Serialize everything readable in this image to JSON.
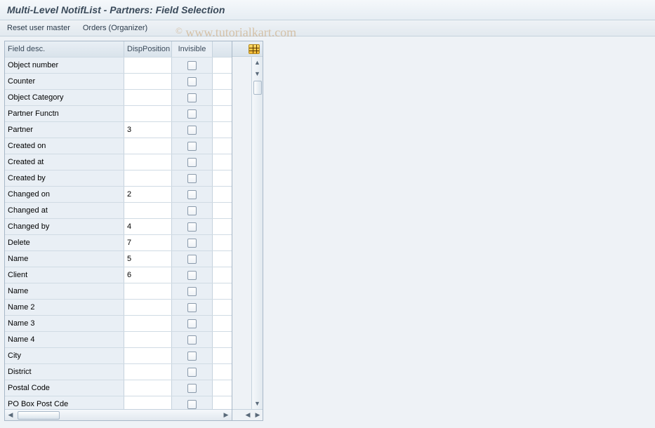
{
  "title": "Multi-Level NotifList - Partners: Field Selection",
  "toolbar": {
    "reset": "Reset user master",
    "orders": "Orders (Organizer)"
  },
  "columns": {
    "field": "Field desc.",
    "pos": "DispPosition",
    "inv": "Invisible"
  },
  "rows": [
    {
      "field": "Object number",
      "pos": ""
    },
    {
      "field": "Counter",
      "pos": ""
    },
    {
      "field": "Object Category",
      "pos": ""
    },
    {
      "field": "Partner Functn",
      "pos": ""
    },
    {
      "field": "Partner",
      "pos": "3"
    },
    {
      "field": "Created on",
      "pos": ""
    },
    {
      "field": "Created at",
      "pos": ""
    },
    {
      "field": "Created by",
      "pos": ""
    },
    {
      "field": "Changed on",
      "pos": "2"
    },
    {
      "field": "Changed at",
      "pos": ""
    },
    {
      "field": "Changed by",
      "pos": "4"
    },
    {
      "field": "Delete",
      "pos": "7"
    },
    {
      "field": "Name",
      "pos": "5"
    },
    {
      "field": "Client",
      "pos": "6"
    },
    {
      "field": "Name",
      "pos": ""
    },
    {
      "field": "Name 2",
      "pos": ""
    },
    {
      "field": "Name 3",
      "pos": ""
    },
    {
      "field": "Name 4",
      "pos": ""
    },
    {
      "field": "City",
      "pos": ""
    },
    {
      "field": "District",
      "pos": ""
    },
    {
      "field": "Postal Code",
      "pos": ""
    },
    {
      "field": "PO Box Post Cde",
      "pos": ""
    }
  ],
  "watermark": "www.tutorialkart.com"
}
